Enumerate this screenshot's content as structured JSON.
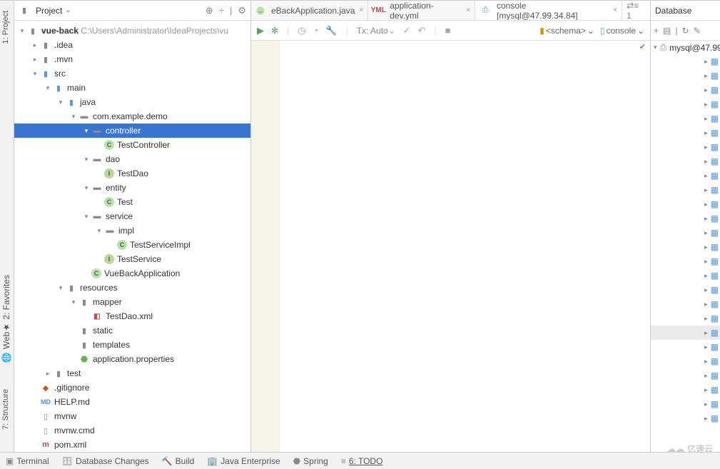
{
  "leftbar": {
    "project": "1: Project",
    "favorites": "2: Favorites",
    "web": "Web",
    "structure": "7: Structure"
  },
  "panel": {
    "title": "Project",
    "collapse": "⌄",
    "icons": [
      "⊕",
      "÷",
      "|",
      "⚙"
    ]
  },
  "root": {
    "name": "vue-back",
    "path": "C:\\Users\\Administrator\\IdeaProjects\\vu"
  },
  "tree": {
    "idea": ".idea",
    "mvn": ".mvn",
    "src": "src",
    "main": "main",
    "java": "java",
    "pkg": "com.example.demo",
    "controller": "controller",
    "testController": "TestController",
    "dao": "dao",
    "testDao": "TestDao",
    "entity": "entity",
    "test": "Test",
    "service": "service",
    "impl": "impl",
    "testServiceImpl": "TestServiceImpl",
    "testService": "TestService",
    "vueBackApp": "VueBackApplication",
    "resources": "resources",
    "mapper": "mapper",
    "testDaoXml": "TestDao.xml",
    "static": "static",
    "templates": "templates",
    "appProps": "application.properties",
    "testDir": "test",
    "gitignore": ".gitignore",
    "helpMd": "HELP.md",
    "mvnw": "mvnw",
    "mvnwCmd": "mvnw.cmd",
    "pom": "pom.xml"
  },
  "tabs": {
    "t1": "eBackApplication.java",
    "t2": "application-dev.yml",
    "t3": "console [mysql@47.99.34.84]",
    "extra": "⇄≡ 1"
  },
  "toolbar": {
    "txAuto": "Tx: Auto",
    "schema": "<schema>",
    "console": "console"
  },
  "db": {
    "title": "Database",
    "icons": [
      "+",
      "▤",
      "|",
      "↻",
      "✎"
    ],
    "conn": "mysql@47.99"
  },
  "bottom": {
    "terminal": "Terminal",
    "dbChanges": "Database Changes",
    "build": "Build",
    "javaEnt": "Java Enterprise",
    "spring": "Spring",
    "todo": "6: TODO"
  },
  "watermark": "亿速云"
}
